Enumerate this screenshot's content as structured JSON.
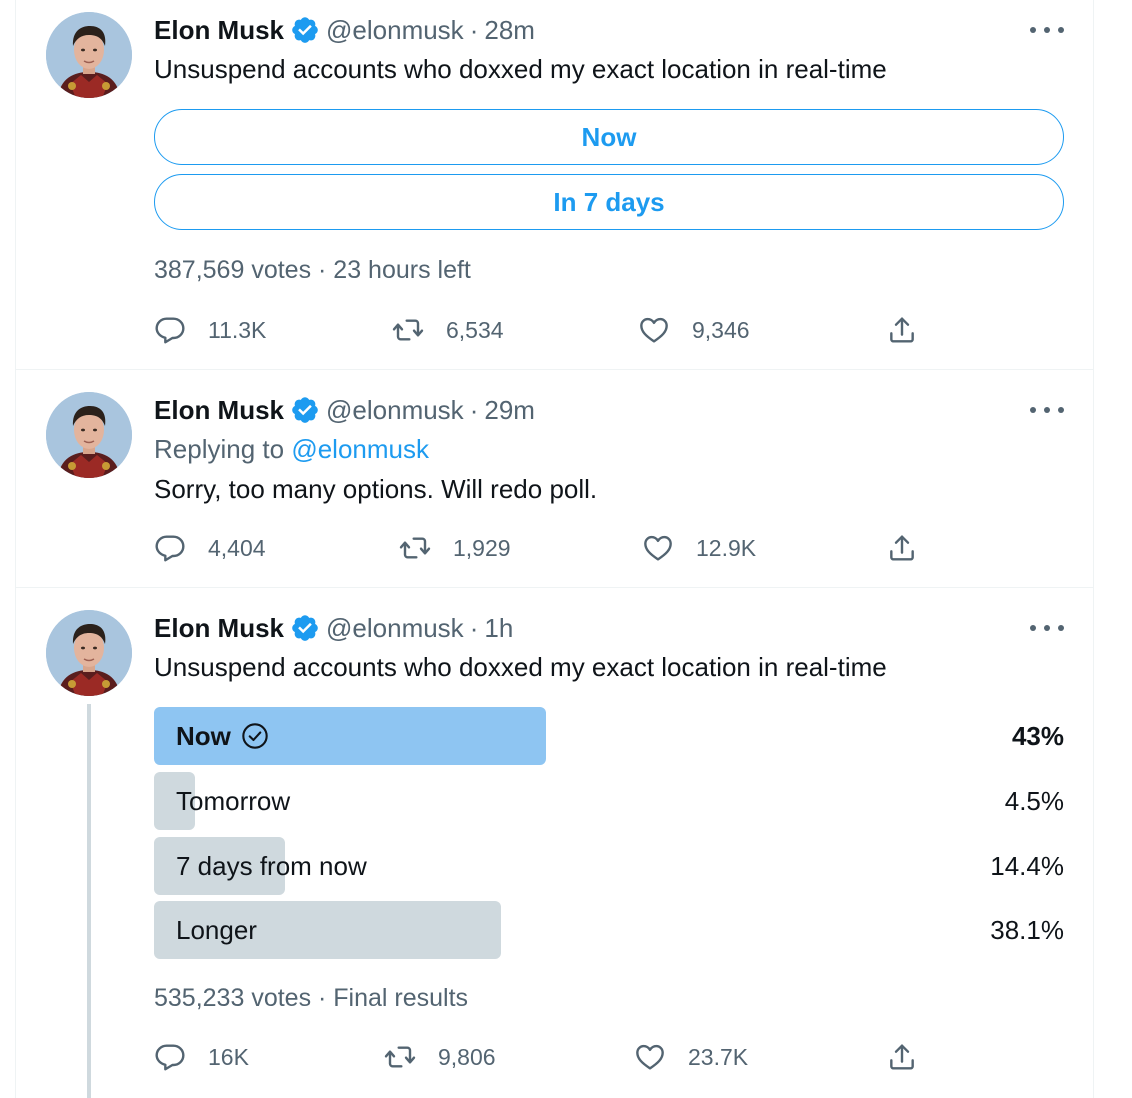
{
  "tweets": [
    {
      "author_name": "Elon Musk",
      "author_handle": "@elonmusk",
      "time": "28m",
      "text": "Unsuspend accounts who doxxed my exact location in real-time",
      "poll_options": [
        "Now",
        "In 7 days"
      ],
      "poll_meta": "387,569 votes · 23 hours left",
      "replies": "11.3K",
      "retweets": "6,534",
      "likes": "9,346"
    },
    {
      "author_name": "Elon Musk",
      "author_handle": "@elonmusk",
      "time": "29m",
      "replying_prefix": "Replying to",
      "replying_to": "@elonmusk",
      "text": "Sorry, too many options. Will redo poll.",
      "replies": "4,404",
      "retweets": "1,929",
      "likes": "12.9K"
    },
    {
      "author_name": "Elon Musk",
      "author_handle": "@elonmusk",
      "time": "1h",
      "text": "Unsuspend accounts who doxxed my exact location in real-time",
      "poll_results": [
        {
          "label": "Now",
          "percent_text": "43%",
          "percent": 43,
          "winner": true
        },
        {
          "label": "Tomorrow",
          "percent_text": "4.5%",
          "percent": 4.5,
          "winner": false
        },
        {
          "label": "7 days from now",
          "percent_text": "14.4%",
          "percent": 14.4,
          "winner": false
        },
        {
          "label": "Longer",
          "percent_text": "38.1%",
          "percent": 38.1,
          "winner": false
        }
      ],
      "poll_meta": "535,233 votes · Final results",
      "replies": "16K",
      "retweets": "9,806",
      "likes": "23.7K"
    }
  ],
  "icons": {
    "verified": "verified-badge-icon",
    "more": "more-options-icon",
    "reply": "reply-icon",
    "retweet": "retweet-icon",
    "like": "like-icon",
    "share": "share-icon",
    "check": "check-circle-icon"
  },
  "colors": {
    "accent": "#1d9bf0",
    "winner_bar": "#8ec5f2",
    "loser_bar": "#cfd9de",
    "secondary_text": "#536471"
  }
}
